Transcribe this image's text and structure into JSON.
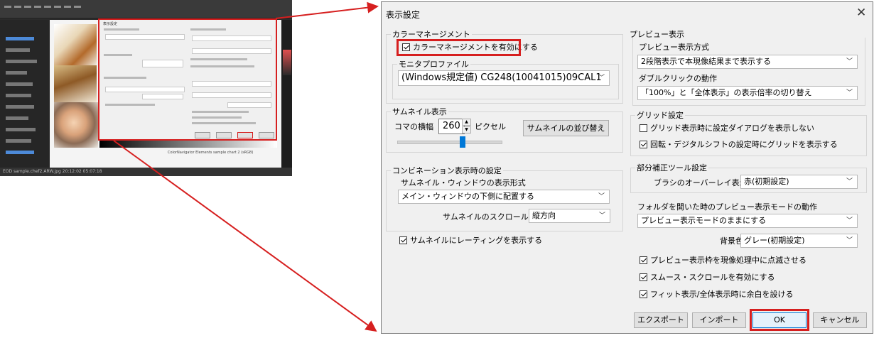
{
  "thumbnail": {
    "status_text": "EOD sample.chef2.ARW.jpg 20:12:02 05:07:18",
    "caption": "ColorNavigator Elements sample chart 2 (sRGB)",
    "dialog_title": "表示設定"
  },
  "dialog": {
    "title": "表示設定",
    "close_glyph": "✕",
    "color_management": {
      "legend": "カラーマネージメント",
      "enable_label": "カラーマネージメントを有効にする",
      "enable_checked": true,
      "monitor_profile": {
        "legend": "モニタプロファイル",
        "value": "(Windows規定値) CG248(10041015)09CAL1"
      }
    },
    "thumbnail_display": {
      "legend": "サムネイル表示",
      "frame_width_label": "コマの横幅",
      "frame_width_value": "260",
      "unit": "ピクセル",
      "sort_button": "サムネイルの並び替え",
      "slider_value": 260
    },
    "combination_display": {
      "legend": "コンビネーション表示時の設定",
      "window_format_label": "サムネイル・ウィンドウの表示形式",
      "window_format_value": "メイン・ウィンドウの下側に配置する",
      "scroll_direction_label": "サムネイルのスクロール方向",
      "scroll_direction_value": "縦方向"
    },
    "rating": {
      "label": "サムネイルにレーティングを表示する",
      "checked": true
    },
    "preview_display": {
      "legend": "プレビュー表示",
      "method_label": "プレビュー表示方式",
      "method_value": "2段階表示で本現像結果まで表示する",
      "doubleclick_label": "ダブルクリックの動作",
      "doubleclick_value": "「100%」と「全体表示」の表示倍率の切り替え"
    },
    "grid": {
      "legend": "グリッド設定",
      "no_dialog_label": "グリッド表示時に設定ダイアログを表示しない",
      "no_dialog_checked": false,
      "rotate_label": "回転・デジタルシフトの設定時にグリッドを表示する",
      "rotate_checked": true
    },
    "partial_tool": {
      "legend": "部分補正ツール設定",
      "overlay_label": "ブラシのオーバーレイ表示色",
      "overlay_value": "赤(初期設定)"
    },
    "folder": {
      "label": "フォルダを開いた時のプレビュー表示モードの動作",
      "value": "プレビュー表示モードのままにする",
      "bg_label": "背景色",
      "bg_value": "グレー(初期設定)"
    },
    "options": [
      {
        "label": "プレビュー表示枠を現像処理中に点滅させる",
        "checked": true
      },
      {
        "label": "スムース・スクロールを有効にする",
        "checked": true
      },
      {
        "label": "フィット表示/全体表示時に余白を設ける",
        "checked": true
      }
    ],
    "buttons": {
      "export": "エクスポート",
      "import": "インポート",
      "ok": "OK",
      "cancel": "キャンセル"
    }
  },
  "colors": {
    "highlight": "#d61f1f",
    "slider_thumb": "#0078d7",
    "dialog_bg": "#f0f0f0"
  }
}
